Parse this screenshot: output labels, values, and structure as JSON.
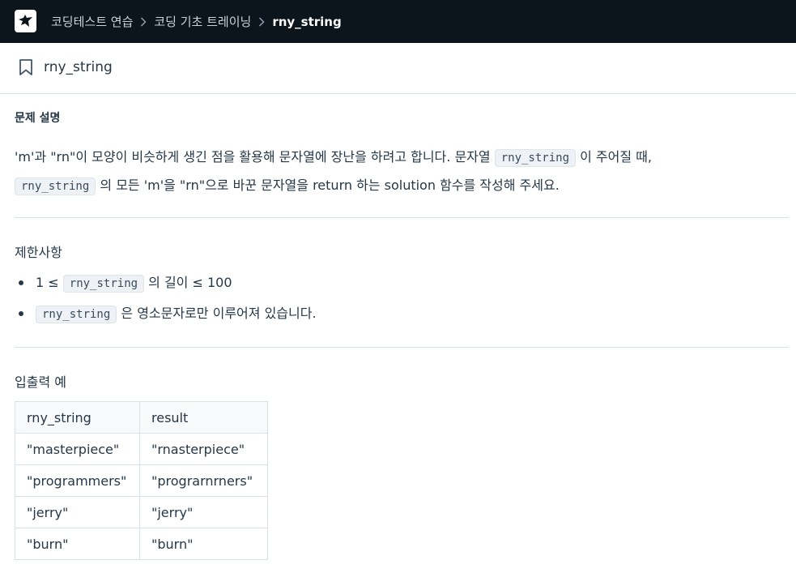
{
  "header": {
    "breadcrumbs": [
      "코딩테스트 연습",
      "코딩 기초 트레이닝",
      "rny_string"
    ],
    "logo_icon": "bird-logo-icon",
    "background_color": "#0c151c"
  },
  "problem": {
    "title": "rny_string",
    "bookmark_icon": "bookmark-icon"
  },
  "description": {
    "heading": "문제 설명",
    "p1": "'m'과 \"rn\"이 모양이 비슷하게 생긴 점을 활용해 문자열에 장난을 하려고 합니다. 문자열",
    "code1": "rny_string",
    "p2": "이 주어질 때,",
    "code2": "rny_string",
    "p3": "의 모든 'm'을 \"rn\"으로 바꾼 문자열을 return 하는 solution 함수를 작성해 주세요."
  },
  "constraints": {
    "heading": "제한사항",
    "item1_pre": "1 ≤",
    "item1_code": "rny_string",
    "item1_post": "의 길이 ≤ 100",
    "item2_code": "rny_string",
    "item2_post": "은 영소문자로만 이루어져 있습니다."
  },
  "examples": {
    "heading": "입출력 예",
    "columns": [
      "rny_string",
      "result"
    ],
    "rows": [
      [
        "\"masterpiece\"",
        "\"rnasterpiece\""
      ],
      [
        "\"programmers\"",
        "\"prograrnrners\""
      ],
      [
        "\"jerry\"",
        "\"jerry\""
      ],
      [
        "\"burn\"",
        "\"burn\""
      ]
    ]
  }
}
